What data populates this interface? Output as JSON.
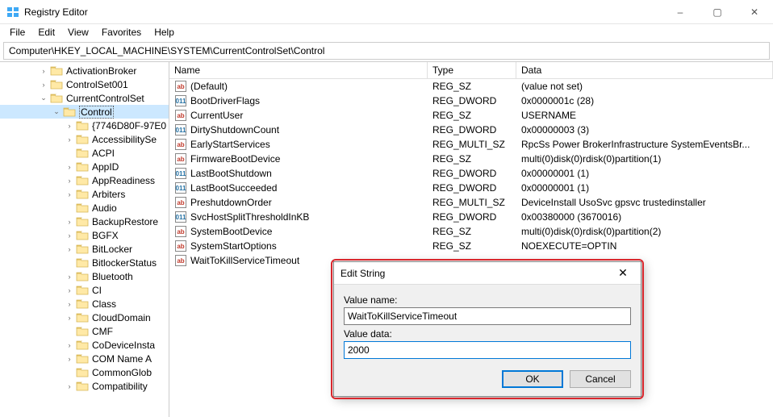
{
  "window": {
    "title": "Registry Editor",
    "min_label": "–",
    "max_label": "▢",
    "close_label": "✕"
  },
  "menu": {
    "items": [
      "File",
      "Edit",
      "View",
      "Favorites",
      "Help"
    ]
  },
  "address": {
    "path": "Computer\\HKEY_LOCAL_MACHINE\\SYSTEM\\CurrentControlSet\\Control"
  },
  "tree": {
    "nodes": [
      {
        "indent": 3,
        "expander": ">",
        "label": "ActivationBroker"
      },
      {
        "indent": 3,
        "expander": ">",
        "label": "ControlSet001"
      },
      {
        "indent": 3,
        "expander": "v",
        "label": "CurrentControlSet"
      },
      {
        "indent": 4,
        "expander": "v",
        "label": "Control",
        "selected": true
      },
      {
        "indent": 5,
        "expander": ">",
        "label": "{7746D80F-97E0"
      },
      {
        "indent": 5,
        "expander": ">",
        "label": "AccessibilitySe"
      },
      {
        "indent": 5,
        "expander": "",
        "label": "ACPI"
      },
      {
        "indent": 5,
        "expander": ">",
        "label": "AppID"
      },
      {
        "indent": 5,
        "expander": ">",
        "label": "AppReadiness"
      },
      {
        "indent": 5,
        "expander": ">",
        "label": "Arbiters"
      },
      {
        "indent": 5,
        "expander": "",
        "label": "Audio"
      },
      {
        "indent": 5,
        "expander": ">",
        "label": "BackupRestore"
      },
      {
        "indent": 5,
        "expander": ">",
        "label": "BGFX"
      },
      {
        "indent": 5,
        "expander": ">",
        "label": "BitLocker"
      },
      {
        "indent": 5,
        "expander": "",
        "label": "BitlockerStatus"
      },
      {
        "indent": 5,
        "expander": ">",
        "label": "Bluetooth"
      },
      {
        "indent": 5,
        "expander": ">",
        "label": "CI"
      },
      {
        "indent": 5,
        "expander": ">",
        "label": "Class"
      },
      {
        "indent": 5,
        "expander": ">",
        "label": "CloudDomain"
      },
      {
        "indent": 5,
        "expander": "",
        "label": "CMF"
      },
      {
        "indent": 5,
        "expander": ">",
        "label": "CoDeviceInsta"
      },
      {
        "indent": 5,
        "expander": ">",
        "label": "COM Name A"
      },
      {
        "indent": 5,
        "expander": "",
        "label": "CommonGlob"
      },
      {
        "indent": 5,
        "expander": ">",
        "label": "Compatibility"
      }
    ]
  },
  "list": {
    "headers": {
      "name": "Name",
      "type": "Type",
      "data": "Data"
    },
    "rows": [
      {
        "icon": "str",
        "name": "(Default)",
        "type": "REG_SZ",
        "data": "(value not set)"
      },
      {
        "icon": "bin",
        "name": "BootDriverFlags",
        "type": "REG_DWORD",
        "data": "0x0000001c (28)"
      },
      {
        "icon": "str",
        "name": "CurrentUser",
        "type": "REG_SZ",
        "data": "USERNAME"
      },
      {
        "icon": "bin",
        "name": "DirtyShutdownCount",
        "type": "REG_DWORD",
        "data": "0x00000003 (3)"
      },
      {
        "icon": "str",
        "name": "EarlyStartServices",
        "type": "REG_MULTI_SZ",
        "data": "RpcSs Power BrokerInfrastructure SystemEventsBr..."
      },
      {
        "icon": "str",
        "name": "FirmwareBootDevice",
        "type": "REG_SZ",
        "data": "multi(0)disk(0)rdisk(0)partition(1)"
      },
      {
        "icon": "bin",
        "name": "LastBootShutdown",
        "type": "REG_DWORD",
        "data": "0x00000001 (1)"
      },
      {
        "icon": "bin",
        "name": "LastBootSucceeded",
        "type": "REG_DWORD",
        "data": "0x00000001 (1)"
      },
      {
        "icon": "str",
        "name": "PreshutdownOrder",
        "type": "REG_MULTI_SZ",
        "data": "DeviceInstall UsoSvc gpsvc trustedinstaller"
      },
      {
        "icon": "bin",
        "name": "SvcHostSplitThresholdInKB",
        "type": "REG_DWORD",
        "data": "0x00380000 (3670016)"
      },
      {
        "icon": "str",
        "name": "SystemBootDevice",
        "type": "REG_SZ",
        "data": "multi(0)disk(0)rdisk(0)partition(2)"
      },
      {
        "icon": "str",
        "name": "SystemStartOptions",
        "type": "REG_SZ",
        "data": " NOEXECUTE=OPTIN"
      },
      {
        "icon": "str",
        "name": "WaitToKillServiceTimeout",
        "type": "",
        "data": ""
      }
    ]
  },
  "dialog": {
    "title": "Edit String",
    "close": "✕",
    "value_name_label": "Value name:",
    "value_name": "WaitToKillServiceTimeout",
    "value_data_label": "Value data:",
    "value_data": "2000",
    "ok": "OK",
    "cancel": "Cancel"
  }
}
